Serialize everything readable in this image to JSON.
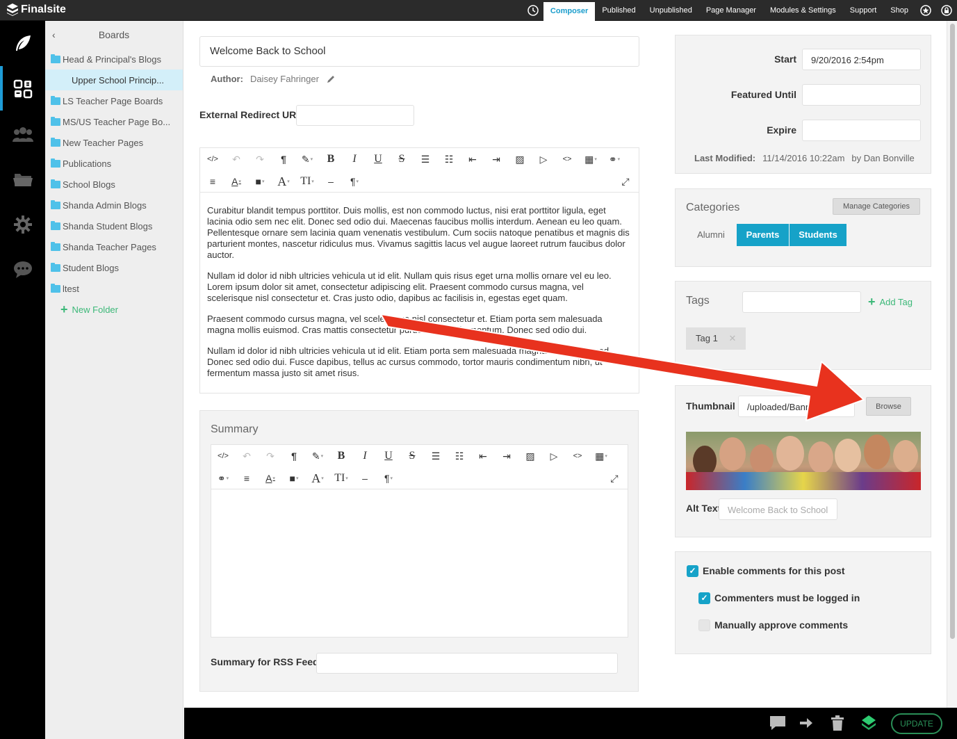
{
  "app": {
    "name": "Finalsite"
  },
  "topnav": {
    "items": [
      {
        "label": "Composer"
      },
      {
        "label": "Published"
      },
      {
        "label": "Unpublished"
      },
      {
        "label": "Page Manager"
      },
      {
        "label": "Modules & Settings"
      },
      {
        "label": "Support"
      },
      {
        "label": "Shop"
      }
    ]
  },
  "sidebar_icons": [
    "feather-icon",
    "dashboard-icon",
    "people-icon",
    "folder-icon",
    "gear-icon",
    "chat-icon"
  ],
  "boards": {
    "title": "Boards",
    "items": [
      {
        "label": "Head & Principal's Blogs"
      },
      {
        "label": "Upper School Princip..."
      },
      {
        "label": "LS Teacher Page Boards"
      },
      {
        "label": "MS/US Teacher Page Bo..."
      },
      {
        "label": "New Teacher Pages"
      },
      {
        "label": "Publications"
      },
      {
        "label": "School Blogs"
      },
      {
        "label": "Shanda Admin Blogs"
      },
      {
        "label": "Shanda Student Blogs"
      },
      {
        "label": "Shanda Teacher Pages"
      },
      {
        "label": "Student Blogs"
      },
      {
        "label": "ltest"
      }
    ],
    "new_folder": "New Folder"
  },
  "post": {
    "title": "Welcome Back to School",
    "author_label": "Author:",
    "author_name": "Daisey Fahringer",
    "external_redirect_label": "External Redirect URL",
    "external_redirect_value": "",
    "body": [
      "Curabitur blandit tempus porttitor. Duis mollis, est non commodo luctus, nisi erat porttitor ligula, eget lacinia odio sem nec elit. Donec sed odio dui. Maecenas faucibus mollis interdum. Aenean eu leo quam. Pellentesque ornare sem lacinia quam venenatis vestibulum. Cum sociis natoque penatibus et magnis dis parturient montes, nascetur ridiculus mus. Vivamus sagittis lacus vel augue laoreet rutrum faucibus dolor auctor.",
      "Nullam id dolor id nibh ultricies vehicula ut id elit. Nullam quis risus eget urna mollis ornare vel eu leo. Lorem ipsum dolor sit amet, consectetur adipiscing elit. Praesent commodo cursus magna, vel scelerisque nisl consectetur et. Cras justo odio, dapibus ac facilisis in, egestas eget quam.",
      "Praesent commodo cursus magna, vel scelerisque nisl consectetur et. Etiam porta sem malesuada magna mollis euismod. Cras mattis consectetur purus sit amet fermentum. Donec sed odio dui.",
      "Nullam id dolor id nibh ultricies vehicula ut id elit. Etiam porta sem malesuada magna mollis euismod. Donec sed odio dui. Fusce dapibus, tellus ac cursus commodo, tortor mauris condimentum nibh, ut fermentum massa justo sit amet risus."
    ]
  },
  "summary": {
    "title": "Summary",
    "rss_label": "Summary for RSS Feeds",
    "rss_value": ""
  },
  "dates": {
    "start_label": "Start",
    "start_value": "9/20/2016 2:54pm",
    "featured_label": "Featured Until",
    "featured_value": "",
    "expire_label": "Expire",
    "expire_value": "",
    "modified_label": "Last Modified:",
    "modified_value": "11/14/2016 10:22am",
    "modified_by": "by Dan Bonville"
  },
  "categories": {
    "title": "Categories",
    "manage_label": "Manage Categories",
    "items": [
      {
        "label": "Alumni",
        "selected": false
      },
      {
        "label": "Parents",
        "selected": true
      },
      {
        "label": "Students",
        "selected": true
      }
    ]
  },
  "tags": {
    "title": "Tags",
    "input_value": "",
    "add_label": "Add Tag",
    "items": [
      {
        "label": "Tag 1"
      }
    ]
  },
  "thumbnail": {
    "label": "Thumbnail",
    "path_value": "/uploaded/Banne",
    "browse_label": "Browse",
    "alt_label": "Alt Text",
    "alt_placeholder": "Welcome Back to School"
  },
  "comments": {
    "enable_label": "Enable comments for this post",
    "enable_checked": true,
    "logged_in_label": "Commenters must be logged in",
    "logged_in_checked": true,
    "approve_label": "Manually approve comments",
    "approve_checked": false
  },
  "bottombar": {
    "update_label": "UPDATE"
  },
  "colors": {
    "accent": "#16a2c8",
    "arrow": "#e8321e",
    "folder": "#4fc1e9",
    "green": "#3cb878"
  }
}
